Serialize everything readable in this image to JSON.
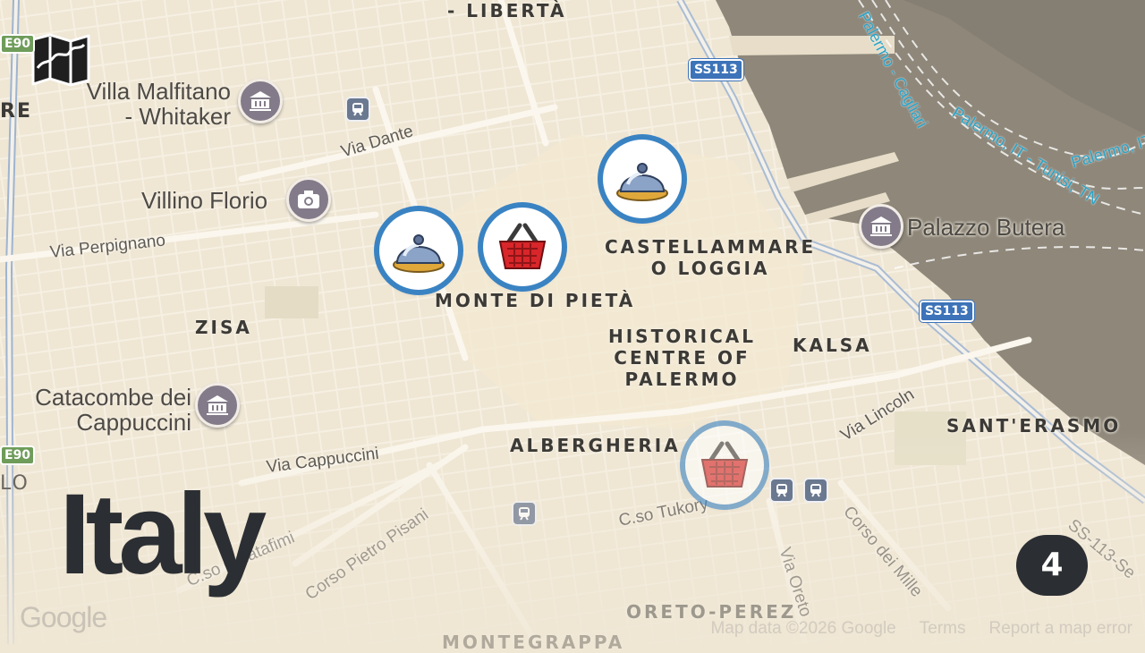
{
  "country": "Italy",
  "badge_count": "4",
  "map_icon": "folded-map-icon",
  "districts": [
    {
      "id": "liberta",
      "text": "- LIBERTÀ"
    },
    {
      "id": "castellammare",
      "text": "CASTELLAMMARE\nO LOGGIA"
    },
    {
      "id": "monte",
      "text": "MONTE DI PIETÀ"
    },
    {
      "id": "historical",
      "text": "HISTORICAL\nCENTRE OF\nPALERMO"
    },
    {
      "id": "kalsa",
      "text": "KALSA"
    },
    {
      "id": "zisa",
      "text": "ZISA"
    },
    {
      "id": "albergheria",
      "text": "ALBERGHERIA"
    },
    {
      "id": "santerasmo",
      "text": "SANT'ERASMO"
    },
    {
      "id": "oreto",
      "text": "ORETO-PEREZ"
    },
    {
      "id": "montegrappa",
      "text": "MONTEGRAPPA"
    }
  ],
  "pois": [
    {
      "id": "villa-malfitano",
      "text": "Villa Malfitano\n- Whitaker",
      "icon": "museum-icon"
    },
    {
      "id": "villino-florio",
      "text": "Villino Florio",
      "icon": "camera-icon"
    },
    {
      "id": "palazzo-butera",
      "text": "Palazzo Butera",
      "icon": "museum-icon"
    },
    {
      "id": "catacombe",
      "text": "Catacombe dei\nCappuccini",
      "icon": "museum-icon"
    }
  ],
  "roads": [
    "Via Dante",
    "Via Perpignano",
    "Via Cappuccini",
    "Corso Pietro Pisani",
    "C.so Calatafimi",
    "C.so Tukory",
    "Via Lincoln",
    "Corso dei Mille",
    "Via Oreto",
    "SS-113-Se"
  ],
  "shields": [
    "SS113",
    "SS113",
    "E90",
    "E90"
  ],
  "ferry_routes": [
    "Palermo - Cagliari",
    "Palermo, IT - Tunisi, TN",
    "Palermo, IT"
  ],
  "edge_fragments": [
    "RE",
    "LO"
  ],
  "markers": [
    {
      "id": "restaurant-1",
      "icon": "cloche-icon",
      "faded": false
    },
    {
      "id": "restaurant-2",
      "icon": "cloche-icon",
      "faded": false
    },
    {
      "id": "shopping-1",
      "icon": "basket-icon",
      "faded": false
    },
    {
      "id": "shopping-2",
      "icon": "basket-icon",
      "faded": true
    }
  ],
  "attribution": {
    "google": "Google",
    "map_data": "Map data ©2026 Google",
    "terms": "Terms",
    "report": "Report a map error"
  },
  "colors": {
    "land": "#efe6d4",
    "water": "#8e877a",
    "marker_ring": "#3a83c3",
    "text_dark": "#2b2f33"
  }
}
